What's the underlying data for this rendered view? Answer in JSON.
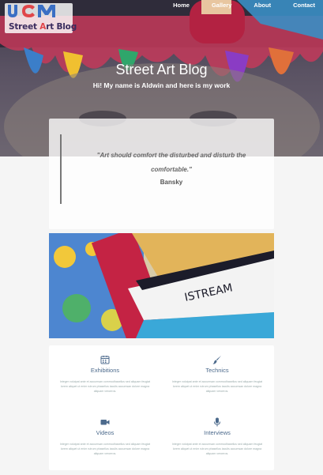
{
  "logo": {
    "brand": "Street Art Blog",
    "brand_prefix": "Street ",
    "brand_a": "A",
    "brand_suffix": "rt Blog"
  },
  "nav": {
    "items": [
      "Home",
      "Gallery",
      "About",
      "Contact"
    ]
  },
  "hero": {
    "title": "Street Art Blog",
    "subtitle": "Hi! My name is Aldwin and here is my work"
  },
  "quote": {
    "text": "\"Art should comfort the disturbed and disturb the comfortable.\"",
    "author": "Bansky"
  },
  "features": [
    {
      "icon": "calendar-icon",
      "title": "Exhibitions",
      "text": "Integer volutpat ante et accumsan commodhasellus sed aliquam feugiat lorem aliquet ut enim rutrum phasellus iaculis accumsan dolore magna aliquam veroeros."
    },
    {
      "icon": "paintbrush-icon",
      "title": "Technics",
      "text": "Integer volutpat ante et accumsan commodhasellus sed aliquam feugiat lorem aliquet ut enim rutrum phasellus iaculis accumsan dolore magna aliquam veroeros."
    },
    {
      "icon": "video-camera-icon",
      "title": "Videos",
      "text": "Integer volutpat ante et accumsan commodhasellus sed aliquam feugiat lorem aliquet ut enim rutrum phasellus iaculis accumsan dolore magna aliquam veroeros."
    },
    {
      "icon": "microphone-icon",
      "title": "Interviews",
      "text": "Integer volutpat ante et accumsan commodhasellus sed aliquam feugiat lorem aliquet ut enim rutrum phasellus iaculis accumsan dolore magna aliquam veroeros."
    }
  ],
  "colors": {
    "accent": "#4c6a8c",
    "brand_red": "#e0464a",
    "brand_purple": "#3a2c5e"
  }
}
